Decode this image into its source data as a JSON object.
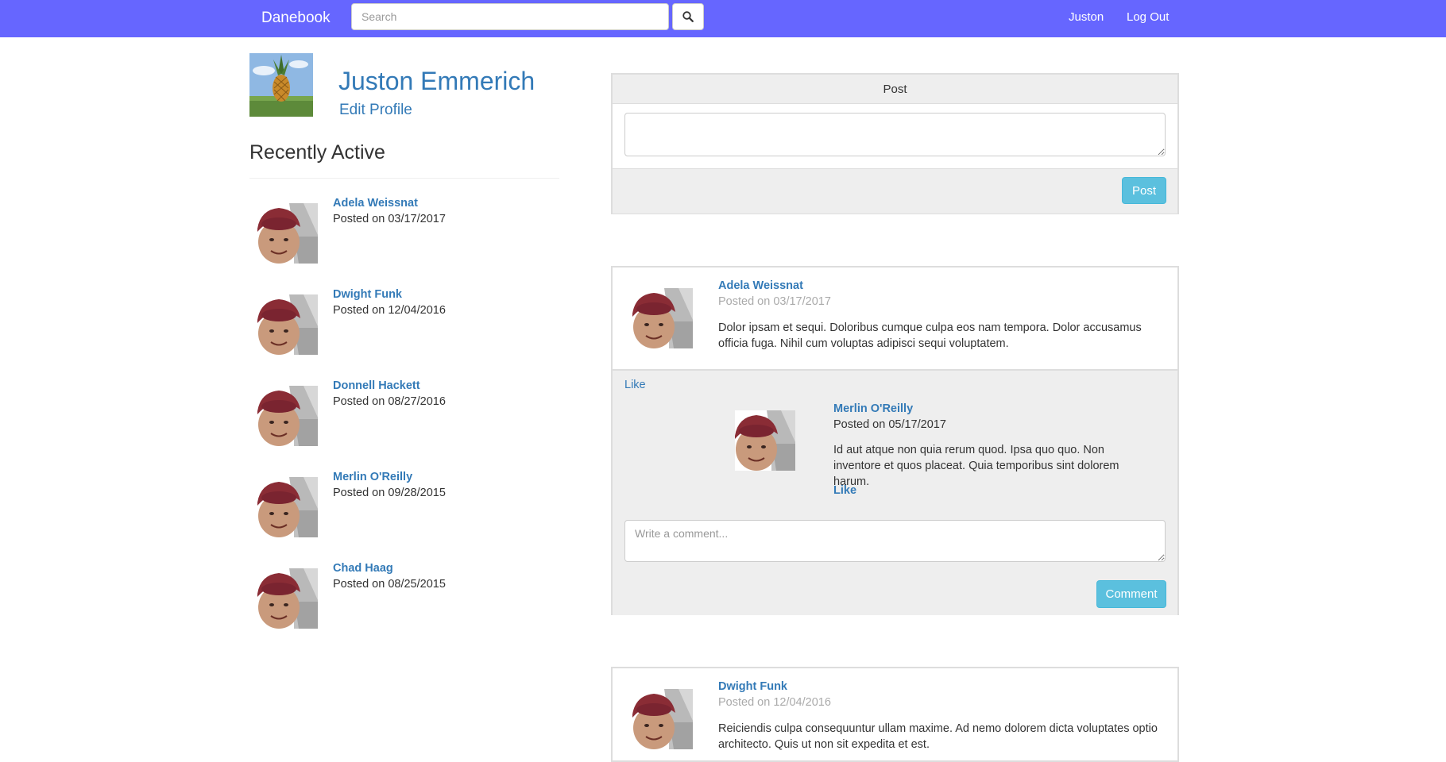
{
  "navbar": {
    "brand": "Danebook",
    "search_placeholder": "Search",
    "user_link": "Juston",
    "logout_link": "Log Out",
    "color": "#6666ff"
  },
  "profile": {
    "name": "Juston Emmerich",
    "edit_label": "Edit Profile"
  },
  "recent": {
    "title": "Recently Active",
    "items": [
      {
        "name": "Adela Weissnat",
        "date": "Posted on 03/17/2017"
      },
      {
        "name": "Dwight Funk",
        "date": "Posted on 12/04/2016"
      },
      {
        "name": "Donnell Hackett",
        "date": "Posted on 08/27/2016"
      },
      {
        "name": "Merlin O'Reilly",
        "date": "Posted on 09/28/2015"
      },
      {
        "name": "Chad Haag",
        "date": "Posted on 08/25/2015"
      }
    ]
  },
  "composer": {
    "header": "Post",
    "button": "Post"
  },
  "posts": [
    {
      "author": "Adela Weissnat",
      "date": "Posted on 03/17/2017",
      "text": "Dolor ipsam et sequi. Doloribus cumque culpa eos nam tempora. Dolor accusamus officia fuga. Nihil cum voluptas adipisci sequi voluptatem.",
      "like_label": "Like",
      "comment": {
        "author": "Merlin O'Reilly",
        "date": "Posted on 05/17/2017",
        "text": "Id aut atque non quia rerum quod. Ipsa quo quo. Non inventore et quos placeat. Quia temporibus sint dolorem harum.",
        "like_label": "Like"
      },
      "comment_placeholder": "Write a comment...",
      "comment_button": "Comment"
    },
    {
      "author": "Dwight Funk",
      "date": "Posted on 12/04/2016",
      "text": "Reiciendis culpa consequuntur ullam maxime. Ad nemo dolorem dicta voluptates optio architecto. Quis ut non sit expedita et est."
    }
  ],
  "icons": {
    "search": "search-icon",
    "profile_photo": "pineapple-photo",
    "user_avatar": "baby-avatar"
  }
}
